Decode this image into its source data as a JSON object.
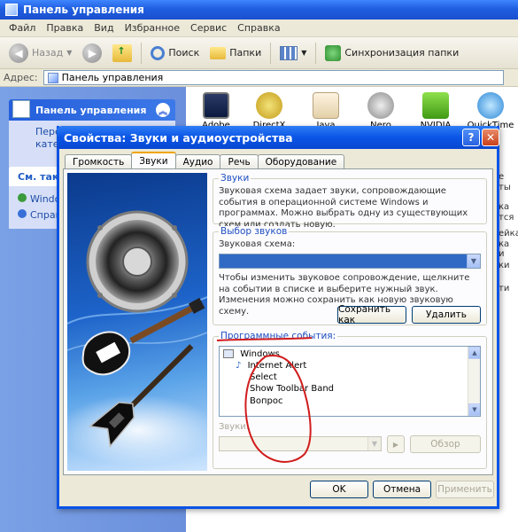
{
  "explorer": {
    "title": "Панель управления",
    "menu": [
      "Файл",
      "Правка",
      "Вид",
      "Избранное",
      "Сервис",
      "Справка"
    ],
    "toolbar": {
      "back": "Назад",
      "search": "Поиск",
      "folders": "Папки",
      "sync": "Синхронизация папки"
    },
    "address": {
      "label": "Адрес:",
      "value": "Панель управления"
    },
    "sidebar": {
      "panel_title": "Панель управления",
      "panel_link_line1": "Пере",
      "panel_link_line2": "кате",
      "see_also_title": "См. такж",
      "see_also_items": [
        "Windo",
        "Справ"
      ]
    },
    "icons": [
      "Adobe",
      "DirectX",
      "Java",
      "Nero",
      "NVIDIA nView",
      "QuickTime"
    ],
    "right_strip": [
      "e",
      "ты",
      "ка",
      "тся",
      "ейка",
      "ка и",
      "ки",
      "ти"
    ]
  },
  "dialog": {
    "title": "Свойства: Звуки и аудиоустройства",
    "help_symbol": "?",
    "close_symbol": "✕",
    "tabs": [
      "Громкость",
      "Звуки",
      "Аудио",
      "Речь",
      "Оборудование"
    ],
    "active_tab": "Звуки",
    "sounds_group": {
      "label": "Звуки",
      "description": "Звуковая схема задает звуки, сопровождающие события в операционной системе Windows и программах. Можно выбрать одну из существующих схем или создать новую."
    },
    "scheme_group": {
      "label": "Выбор звуков",
      "scheme_label": "Звуковая схема:",
      "scheme_value": "",
      "hint": "Чтобы изменить звуковое сопровождение, щелкните на событии в списке и выберите нужный звук. Изменения можно сохранить как новую звуковую схему.",
      "save_as": "Сохранить как",
      "delete": "Удалить"
    },
    "events_group": {
      "label": "Программные события:",
      "items": [
        "Windows",
        "Internet Alert",
        "Select",
        "Show Toolbar Band",
        "Вопрос"
      ]
    },
    "sounds_field_label": "Звуки:",
    "play_symbol": "▶",
    "browse": "Обзор",
    "ok": "OK",
    "cancel": "Отмена",
    "apply": "Применить"
  },
  "colors": {
    "xp_blue": "#0a53e6",
    "selection": "#316ac5",
    "annotation_red": "#d11c1c"
  }
}
